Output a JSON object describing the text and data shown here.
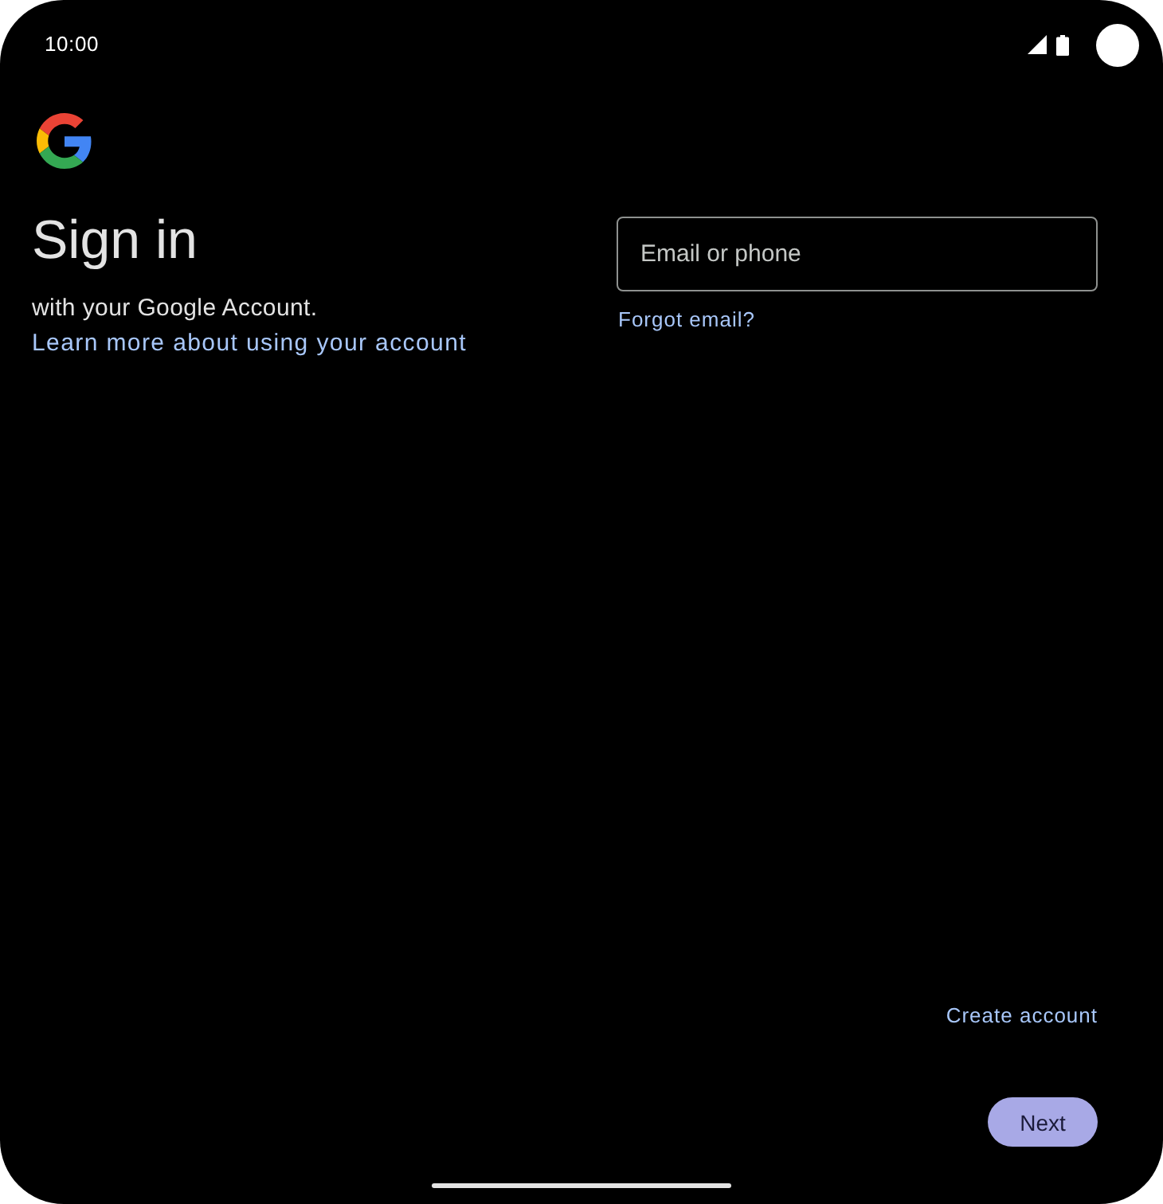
{
  "status_bar": {
    "time": "10:00"
  },
  "header": {
    "title": "Sign in",
    "subtitle": "with your Google Account.",
    "learn_more_link": "Learn more about using your account"
  },
  "email_field": {
    "placeholder": "Email or phone"
  },
  "forgot_email_link": "Forgot email?",
  "create_account_link": "Create account",
  "next_button": "Next"
}
